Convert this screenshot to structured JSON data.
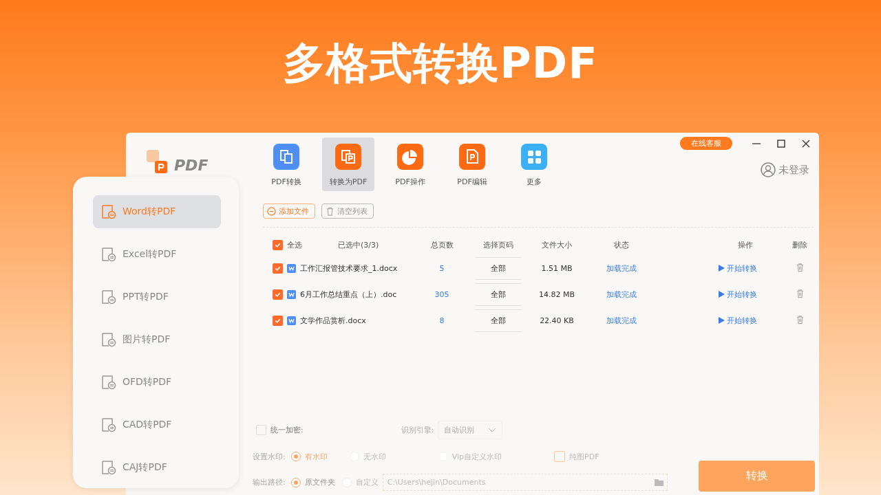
{
  "headline": "多格式转换PDF",
  "window": {
    "logo_text": "PDF",
    "toolbar": [
      {
        "label": "PDF转换",
        "kind": "convert",
        "color": "#4f8ef7",
        "selected": false
      },
      {
        "label": "转换为PDF",
        "kind": "to-pdf",
        "color": "#ff6a13",
        "selected": true
      },
      {
        "label": "PDF操作",
        "kind": "operate",
        "color": "#ff6a13",
        "selected": false
      },
      {
        "label": "PDF编辑",
        "kind": "edit",
        "color": "#ff6a13",
        "selected": false
      },
      {
        "label": "更多",
        "kind": "more",
        "color": "#3bb0f7",
        "selected": false
      }
    ],
    "support_button": "在线客服",
    "user_label": "未登录"
  },
  "sidebar": [
    {
      "label": "Word转PDF",
      "selected": true
    },
    {
      "label": "Excel转PDF",
      "selected": false
    },
    {
      "label": "PPT转PDF",
      "selected": false
    },
    {
      "label": "图片转PDF",
      "selected": false
    },
    {
      "label": "OFD转PDF",
      "selected": false
    },
    {
      "label": "CAD转PDF",
      "selected": false
    },
    {
      "label": "CAJ转PDF",
      "selected": false
    }
  ],
  "actions": [
    {
      "label": "添加文件",
      "kind": "add"
    },
    {
      "label": "清空列表",
      "kind": "clear"
    }
  ],
  "table": {
    "select_all": {
      "label": "全选",
      "checked": true
    },
    "selected_count": "已选中(3/3)",
    "columns": [
      "总页数",
      "选择页码",
      "文件大小",
      "状态",
      "操作",
      "删除"
    ],
    "rows": [
      {
        "checked": true,
        "name": "工作汇报管技术要求_1.docx",
        "pages": "5",
        "page_range": "全部",
        "size": "1.51 MB",
        "status": "加载完成",
        "action": "开始转换"
      },
      {
        "checked": true,
        "name": "6月工作总结重点（上）.doc",
        "pages": "305",
        "page_range": "全部",
        "size": "14.82 MB",
        "status": "加载完成",
        "action": "开始转换"
      },
      {
        "checked": true,
        "name": "文学作品赏析.docx",
        "pages": "8",
        "page_range": "全部",
        "size": "22.40 KB",
        "status": "加载完成",
        "action": "开始转换"
      }
    ]
  },
  "options": {
    "encrypt": {
      "label": "统一加密:",
      "checked": false
    },
    "engine": {
      "label": "识别引擎:",
      "value": "自动识别"
    },
    "watermark": {
      "label": "设置水印:",
      "choices": [
        {
          "label": "有水印",
          "selected": true
        },
        {
          "label": "无水印",
          "selected": false
        },
        {
          "label": "Vip自定义水印",
          "selected": false
        }
      ],
      "pure_image": {
        "label": "纯图PDF",
        "checked": false
      }
    },
    "output": {
      "label": "输出路径:",
      "choices": [
        {
          "label": "原文件夹",
          "selected": true
        },
        {
          "label": "自定义",
          "selected": false
        }
      ],
      "path": "C:\\Users\\hejin\\Documents"
    }
  },
  "convert_button": "转换"
}
